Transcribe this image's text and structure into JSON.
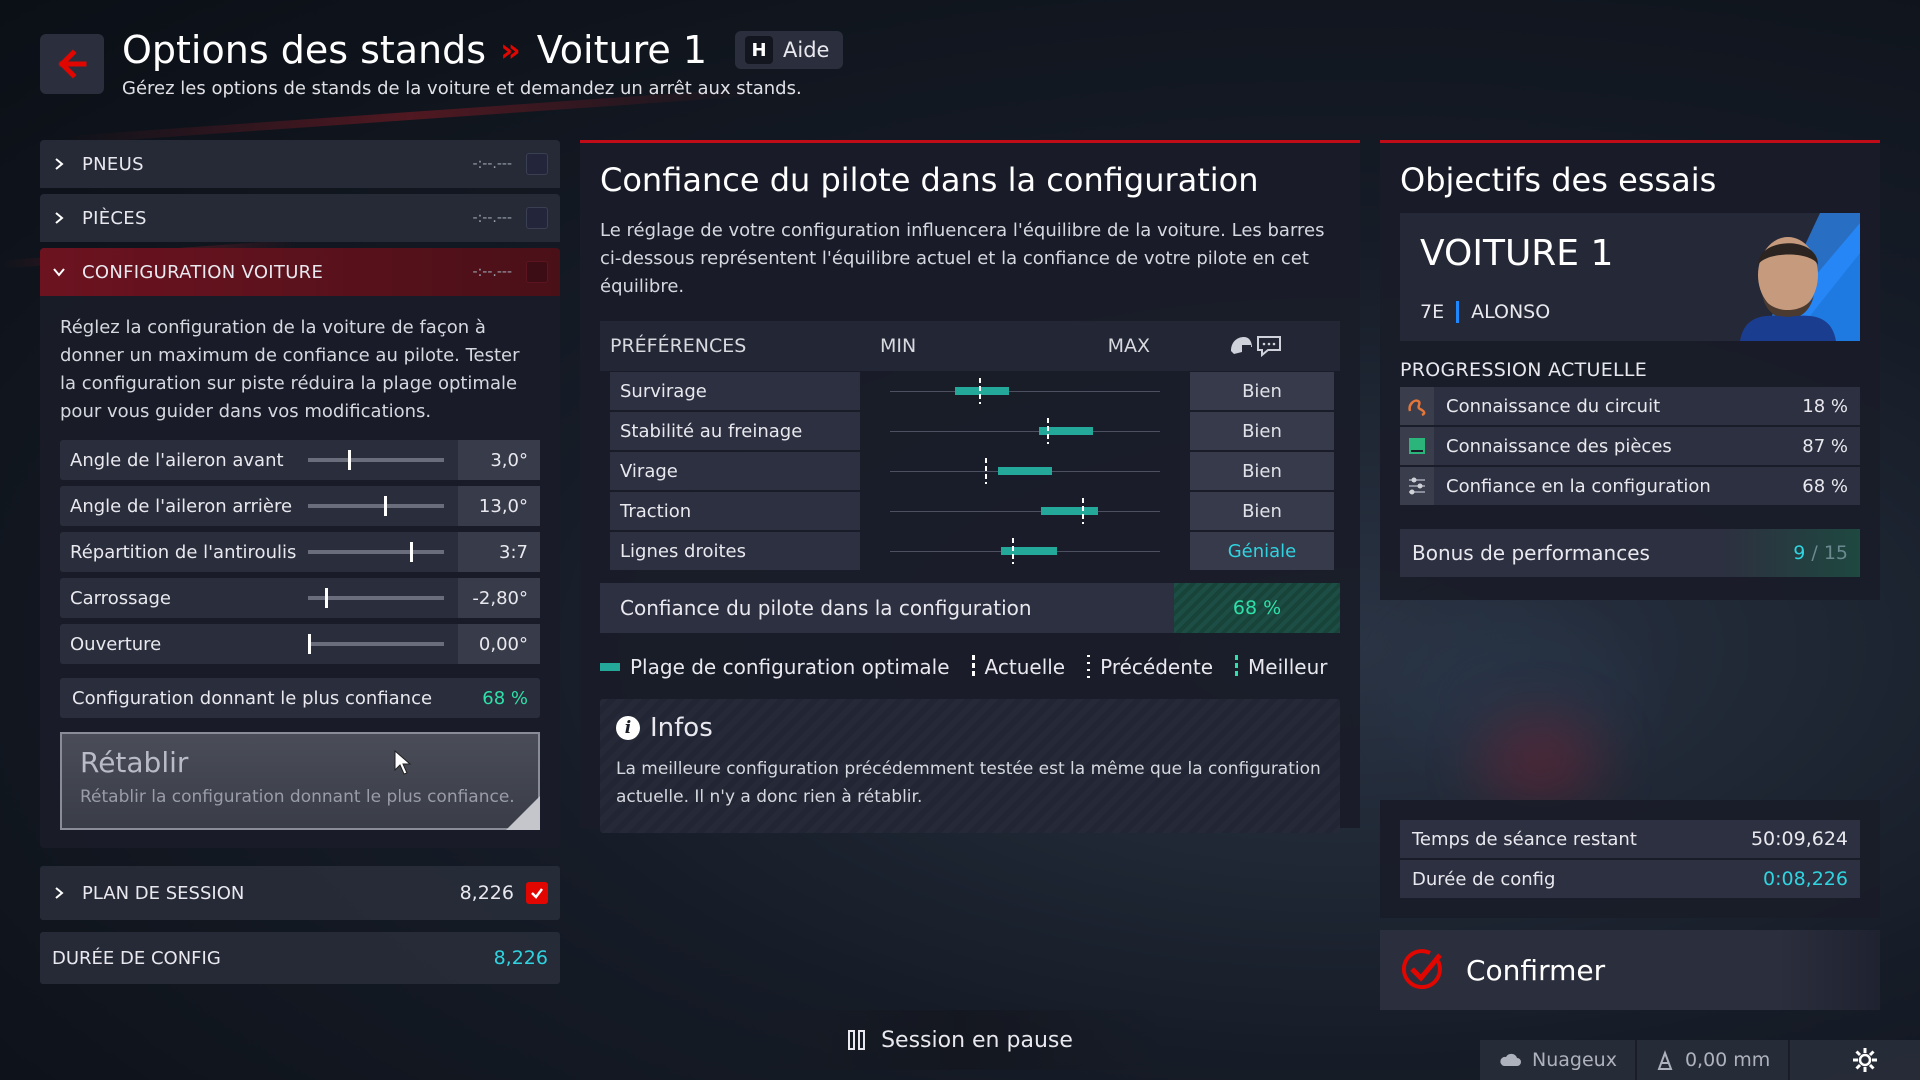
{
  "header": {
    "title": "Options des stands",
    "separator": "»",
    "car": "Voiture 1",
    "help_key": "H",
    "help_label": "Aide",
    "subtitle": "Gérez les options de stands de la voiture et demandez un arrêt aux stands."
  },
  "left": {
    "sections": [
      {
        "label": "PNEUS",
        "value": "-:--.---"
      },
      {
        "label": "PIÈCES",
        "value": "-:--.---"
      },
      {
        "label": "CONFIGURATION VOITURE",
        "value": "-:--.---"
      }
    ],
    "config_description": "Réglez la configuration de la voiture de façon à donner un maximum de confiance au pilote. Tester la configuration sur piste réduira la plage optimale pour vous guider dans vos modifications.",
    "sliders": [
      {
        "label": "Angle de l'aileron avant",
        "value": "3,0°",
        "level": 0.3
      },
      {
        "label": "Angle de l'aileron arrière",
        "value": "13,0°",
        "level": 0.57
      },
      {
        "label": "Répartition de l'antiroulis",
        "value": "3:7",
        "level": 0.77
      },
      {
        "label": "Carrossage",
        "value": "-2,80°",
        "level": 0.13
      },
      {
        "label": "Ouverture",
        "value": "0,00°",
        "level": 0.0
      }
    ],
    "best_config_label": "Configuration donnant le plus confiance",
    "best_config_value": "68 %",
    "reset_title": "Rétablir",
    "reset_subtitle": "Rétablir la configuration donnant le plus confiance.",
    "plan_label": "PLAN DE SESSION",
    "plan_value": "8,226",
    "duration_label": "DURÉE DE CONFIG",
    "duration_value": "8,226"
  },
  "middle": {
    "title": "Confiance du pilote dans la configuration",
    "description": "Le réglage de votre configuration influencera l'équilibre de la voiture. Les barres ci-dessous représentent l'équilibre actuel et la confiance de votre pilote en cet équilibre.",
    "col_preferences": "PRÉFÉRENCES",
    "col_min": "MIN",
    "col_max": "MAX",
    "rows": [
      {
        "label": "Survirage",
        "rating": "Bien",
        "range": [
          0.24,
          0.44
        ],
        "current": 0.33
      },
      {
        "label": "Stabilité au freinage",
        "rating": "Bien",
        "range": [
          0.55,
          0.75
        ],
        "current": 0.58
      },
      {
        "label": "Virage",
        "rating": "Bien",
        "range": [
          0.4,
          0.6
        ],
        "current": 0.35
      },
      {
        "label": "Traction",
        "rating": "Bien",
        "range": [
          0.56,
          0.77
        ],
        "current": 0.71
      },
      {
        "label": "Lignes droites",
        "rating": "Géniale",
        "range": [
          0.41,
          0.62
        ],
        "current": 0.45
      }
    ],
    "confidence_label": "Confiance du pilote dans la configuration",
    "confidence_value": "68 %",
    "legend": {
      "optimal": "Plage de configuration optimale",
      "current": "Actuelle",
      "previous": "Précédente",
      "best": "Meilleur"
    },
    "infos_title": "Infos",
    "infos_text": "La meilleure configuration précédemment testée est la même que la configuration actuelle. Il n'y a donc rien à rétablir."
  },
  "right": {
    "title": "Objectifs des essais",
    "car_name": "VOITURE 1",
    "position": "7E",
    "driver": "ALONSO",
    "progress_title": "PROGRESSION ACTUELLE",
    "progress": [
      {
        "label": "Connaissance du circuit",
        "value": "18 %",
        "icon": "track-icon"
      },
      {
        "label": "Connaissance des pièces",
        "value": "87 %",
        "icon": "parts-icon"
      },
      {
        "label": "Confiance en la configuration",
        "value": "68 %",
        "icon": "setup-icon"
      }
    ],
    "bonus_label": "Bonus de performances",
    "bonus_value": "9",
    "bonus_total": "/ 15",
    "session_time_label": "Temps de séance restant",
    "session_time_value": "50:09,624",
    "config_duration_label": "Durée de config",
    "config_duration_value": "0:08,226",
    "confirm_label": "Confirmer"
  },
  "footer": {
    "pause_label": "Session en pause",
    "weather": "Nuageux",
    "rain": "0,00 mm"
  },
  "colors": {
    "accent_red": "#e10600",
    "teal": "#24a89a",
    "cyan": "#2fd4e0",
    "green": "#2fe0a8"
  }
}
